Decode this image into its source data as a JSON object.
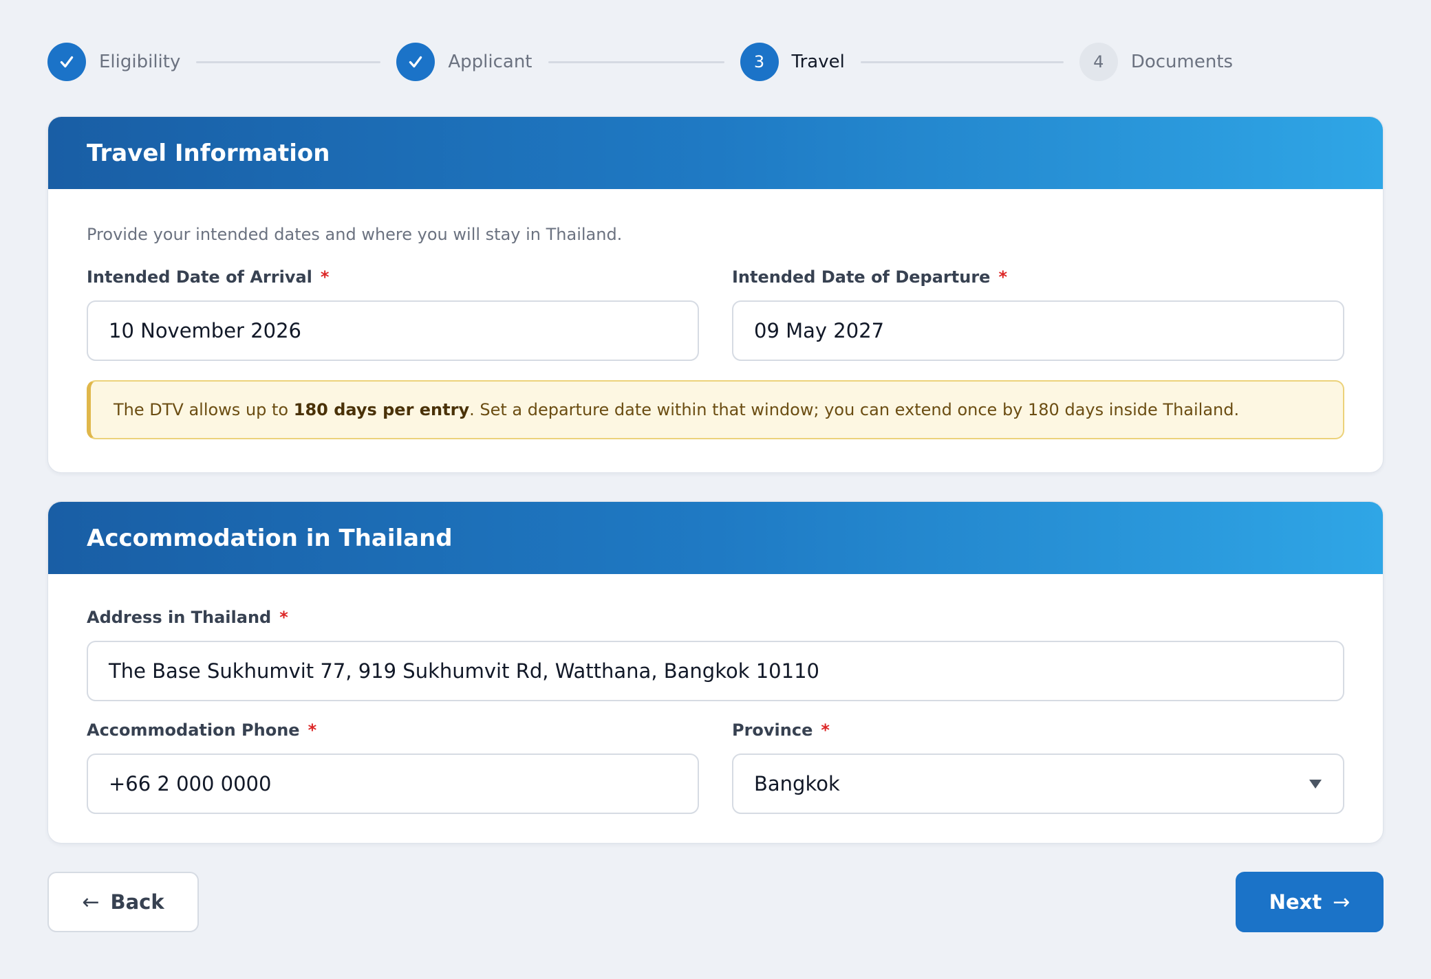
{
  "stepper": {
    "steps": [
      {
        "number": "1",
        "label": "Eligibility",
        "status": "complete"
      },
      {
        "number": "2",
        "label": "Applicant",
        "status": "complete"
      },
      {
        "number": "3",
        "label": "Travel",
        "status": "current"
      },
      {
        "number": "4",
        "label": "Documents",
        "status": "pending"
      }
    ],
    "check_icon": "checkmark-icon"
  },
  "travel": {
    "title": "Travel Information",
    "intro": "Provide your intended dates and where you will stay in Thailand.",
    "arrival": {
      "label": "Intended Date of Arrival",
      "required_mark": "*",
      "value": "10 November 2026"
    },
    "departure": {
      "label": "Intended Date of Departure",
      "required_mark": "*",
      "value": "09 May 2027"
    },
    "notice": {
      "prefix": "The DTV allows up to ",
      "emphasis": "180 days per entry",
      "suffix": ". Set a departure date within that window; you can extend once by 180 days inside Thailand."
    }
  },
  "accommodation": {
    "title": "Accommodation in Thailand",
    "address": {
      "label": "Address in Thailand",
      "required_mark": "*",
      "value": "The Base Sukhumvit 77, 919 Sukhumvit Rd, Watthana, Bangkok 10110"
    },
    "phone": {
      "label": "Accommodation Phone",
      "required_mark": "*",
      "value": "+66 2 000 0000"
    },
    "province": {
      "label": "Province",
      "required_mark": "*",
      "value": "Bangkok"
    }
  },
  "footer": {
    "back_arrow": "←",
    "back_label": "Back",
    "next_label": "Next",
    "next_arrow": "→"
  },
  "colors": {
    "primary": "#1b73c8",
    "header_gradient_start": "#195ea5",
    "header_gradient_end": "#2fa6e6",
    "required": "#dc2626",
    "notice_bg": "#fdf7e2",
    "notice_border": "#e0b74a",
    "page_bg": "#eef1f6"
  }
}
